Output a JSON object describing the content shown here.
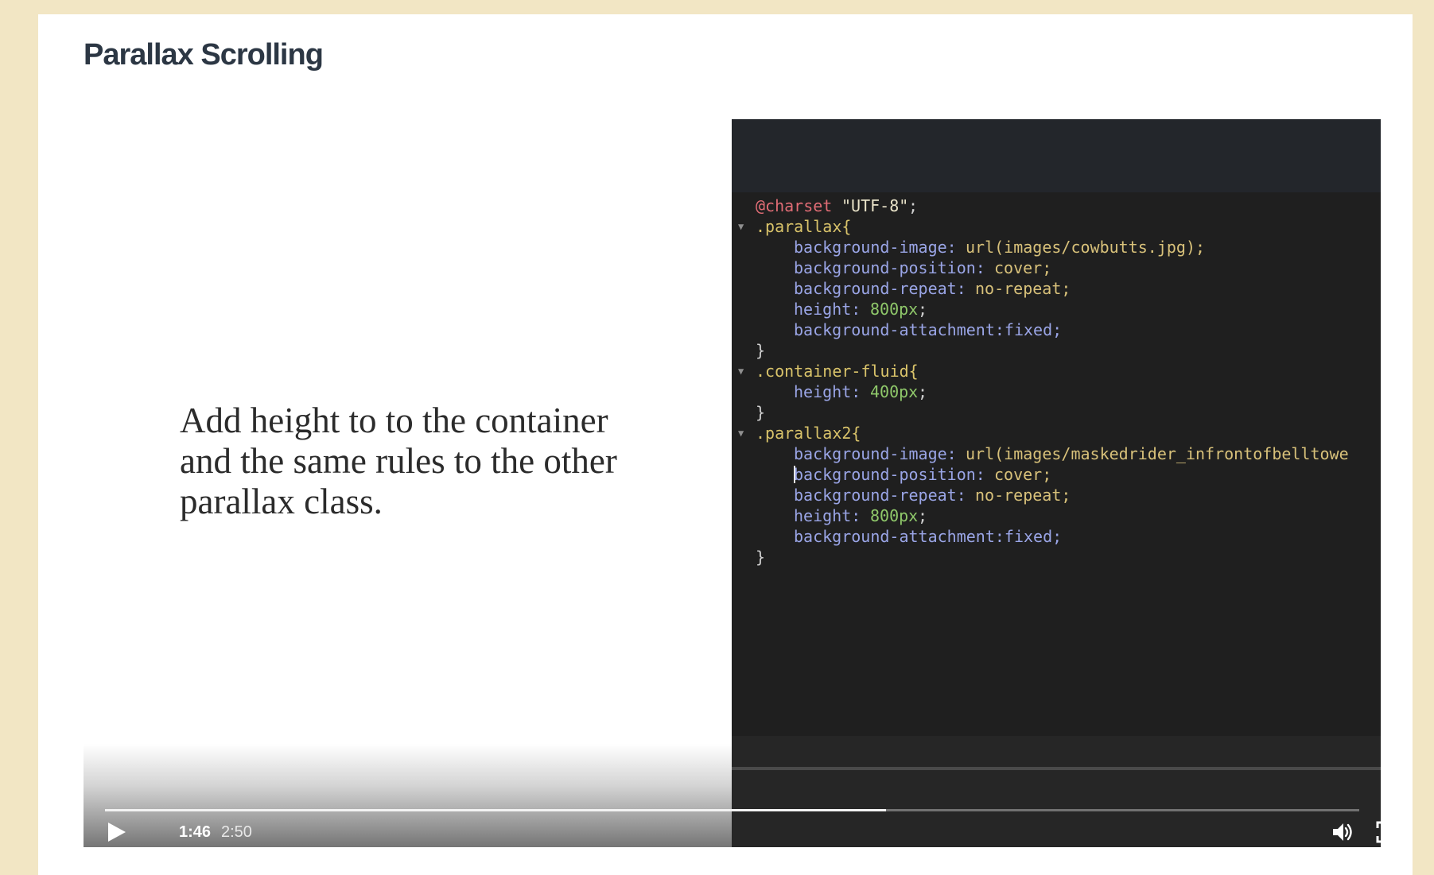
{
  "page": {
    "title": "Parallax Scrolling"
  },
  "video": {
    "slide_text": "Add height to to the container and the same rules to the other parallax class.",
    "current_time": "1:46",
    "duration": "2:50",
    "progress_fraction": 0.623,
    "code_lines": [
      {
        "arrow": "",
        "tokens": [
          {
            "t": "@charset",
            "c": "at",
            "col": 0
          },
          {
            "t": "\"UTF-8\"",
            "c": "str",
            "col": 9
          },
          {
            "t": ";",
            "c": "punct",
            "col": 16
          }
        ]
      },
      {
        "arrow": "▼",
        "tokens": [
          {
            "t": ".parallax{",
            "c": "sel",
            "col": 0
          }
        ]
      },
      {
        "arrow": "",
        "tokens": [
          {
            "t": "background-image:",
            "c": "prop",
            "col": 4
          },
          {
            "t": "url(images/cowbutts.jpg);",
            "c": "val",
            "col": 22
          }
        ]
      },
      {
        "arrow": "",
        "tokens": [
          {
            "t": "background-position:",
            "c": "prop",
            "col": 4
          },
          {
            "t": "cover;",
            "c": "val",
            "col": 25
          }
        ]
      },
      {
        "arrow": "",
        "tokens": [
          {
            "t": "background-repeat:",
            "c": "prop",
            "col": 4
          },
          {
            "t": "no-repeat;",
            "c": "val",
            "col": 23
          }
        ]
      },
      {
        "arrow": "",
        "tokens": [
          {
            "t": "height:",
            "c": "prop",
            "col": 4
          },
          {
            "t": "800px",
            "c": "num",
            "col": 12
          },
          {
            "t": ";",
            "c": "punct",
            "col": 17
          }
        ]
      },
      {
        "arrow": "",
        "tokens": [
          {
            "t": "background-attachment:fixed;",
            "c": "prop",
            "col": 4
          }
        ]
      },
      {
        "arrow": "",
        "tokens": [
          {
            "t": "}",
            "c": "punct",
            "col": 0
          }
        ]
      },
      {
        "arrow": "▼",
        "tokens": [
          {
            "t": ".container-fluid{",
            "c": "sel",
            "col": 0
          }
        ]
      },
      {
        "arrow": "",
        "tokens": [
          {
            "t": "height:",
            "c": "prop",
            "col": 4
          },
          {
            "t": "400px",
            "c": "num",
            "col": 12
          },
          {
            "t": ";",
            "c": "punct",
            "col": 17
          }
        ]
      },
      {
        "arrow": "",
        "tokens": [
          {
            "t": "}",
            "c": "punct",
            "col": 0
          }
        ]
      },
      {
        "arrow": "▼",
        "tokens": [
          {
            "t": ".parallax2{",
            "c": "sel",
            "col": 0
          }
        ]
      },
      {
        "arrow": "",
        "tokens": [
          {
            "t": "background-image:",
            "c": "prop",
            "col": 4
          },
          {
            "t": "url(images/maskedrider_infrontofbelltowe",
            "c": "val",
            "col": 22
          }
        ]
      },
      {
        "arrow": "",
        "caret": true,
        "tokens": [
          {
            "t": "background-position:",
            "c": "prop",
            "col": 4
          },
          {
            "t": "cover;",
            "c": "val",
            "col": 25
          }
        ]
      },
      {
        "arrow": "",
        "tokens": [
          {
            "t": "background-repeat:",
            "c": "prop",
            "col": 4
          },
          {
            "t": "no-repeat;",
            "c": "val",
            "col": 23
          }
        ]
      },
      {
        "arrow": "",
        "tokens": [
          {
            "t": "height:",
            "c": "prop",
            "col": 4
          },
          {
            "t": "800px",
            "c": "num",
            "col": 12
          },
          {
            "t": ";",
            "c": "punct",
            "col": 17
          }
        ]
      },
      {
        "arrow": "",
        "tokens": [
          {
            "t": "background-attachment:fixed;",
            "c": "prop",
            "col": 4
          }
        ]
      },
      {
        "arrow": "",
        "tokens": [
          {
            "t": "}",
            "c": "punct",
            "col": 0
          }
        ]
      }
    ],
    "icons": {
      "play": "play-icon",
      "volume": "volume-icon",
      "fullscreen": "fullscreen-icon"
    }
  }
}
